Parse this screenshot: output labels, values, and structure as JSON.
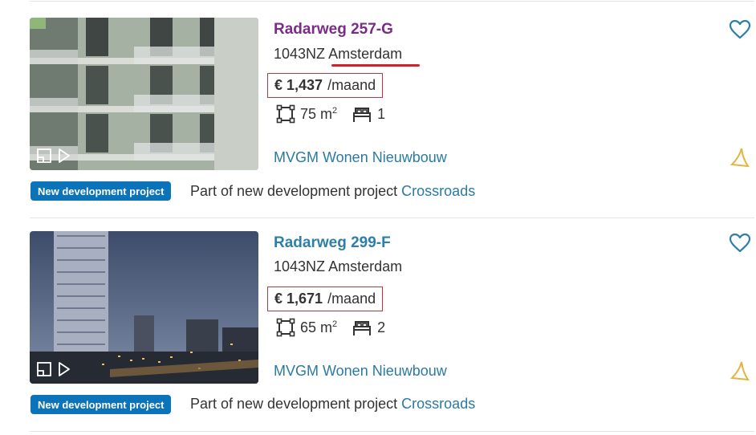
{
  "listings": [
    {
      "title": "Radarweg 257-G",
      "postcode": "1043NZ",
      "city": "Amsterdam",
      "price": "€ 1,437",
      "price_period": "/maand",
      "area": "75 m",
      "area_unit_sup": "2",
      "rooms": "1",
      "agent": "MVGM Wonen Nieuwbouw",
      "badge": "New development project",
      "project_prefix": "Part of new development project",
      "project_link": "Crossroads",
      "visited": true
    },
    {
      "title": "Radarweg 299-F",
      "postcode": "1043NZ",
      "city": "Amsterdam",
      "price": "€ 1,671",
      "price_period": "/maand",
      "area": "65 m",
      "area_unit_sup": "2",
      "rooms": "2",
      "agent": "MVGM Wonen Nieuwbouw",
      "badge": "New development project",
      "project_prefix": "Part of new development project",
      "project_link": "Crossroads",
      "visited": false
    }
  ],
  "icons": {
    "favorite": "heart-outline-icon",
    "agent_logo": "agent-logo-icon",
    "floorplan": "floorplan-icon",
    "play": "play-icon",
    "area": "area-icon",
    "bed": "bed-icon"
  },
  "colors": {
    "title_visited": "#7a2c87",
    "title_link": "#2e7fa8",
    "badge_bg": "#0b73b9",
    "highlight_red": "#c9343c",
    "link_blue": "#2a7aa3"
  }
}
